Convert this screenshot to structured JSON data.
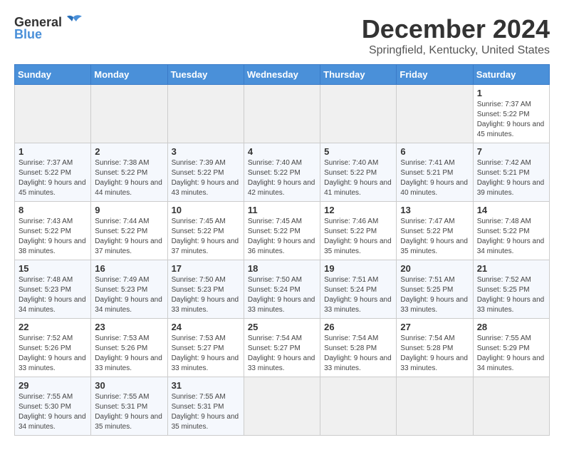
{
  "header": {
    "logo_general": "General",
    "logo_blue": "Blue",
    "month_title": "December 2024",
    "location": "Springfield, Kentucky, United States"
  },
  "calendar": {
    "days_of_week": [
      "Sunday",
      "Monday",
      "Tuesday",
      "Wednesday",
      "Thursday",
      "Friday",
      "Saturday"
    ],
    "weeks": [
      [
        null,
        null,
        null,
        null,
        null,
        null,
        {
          "day": "1",
          "sunrise": "Sunrise: 7:37 AM",
          "sunset": "Sunset: 5:22 PM",
          "daylight": "Daylight: 9 hours and 45 minutes."
        }
      ],
      [
        {
          "day": "1",
          "sunrise": "Sunrise: 7:37 AM",
          "sunset": "Sunset: 5:22 PM",
          "daylight": "Daylight: 9 hours and 45 minutes."
        },
        {
          "day": "2",
          "sunrise": "Sunrise: 7:38 AM",
          "sunset": "Sunset: 5:22 PM",
          "daylight": "Daylight: 9 hours and 44 minutes."
        },
        {
          "day": "3",
          "sunrise": "Sunrise: 7:39 AM",
          "sunset": "Sunset: 5:22 PM",
          "daylight": "Daylight: 9 hours and 43 minutes."
        },
        {
          "day": "4",
          "sunrise": "Sunrise: 7:40 AM",
          "sunset": "Sunset: 5:22 PM",
          "daylight": "Daylight: 9 hours and 42 minutes."
        },
        {
          "day": "5",
          "sunrise": "Sunrise: 7:40 AM",
          "sunset": "Sunset: 5:22 PM",
          "daylight": "Daylight: 9 hours and 41 minutes."
        },
        {
          "day": "6",
          "sunrise": "Sunrise: 7:41 AM",
          "sunset": "Sunset: 5:21 PM",
          "daylight": "Daylight: 9 hours and 40 minutes."
        },
        {
          "day": "7",
          "sunrise": "Sunrise: 7:42 AM",
          "sunset": "Sunset: 5:21 PM",
          "daylight": "Daylight: 9 hours and 39 minutes."
        }
      ],
      [
        {
          "day": "8",
          "sunrise": "Sunrise: 7:43 AM",
          "sunset": "Sunset: 5:22 PM",
          "daylight": "Daylight: 9 hours and 38 minutes."
        },
        {
          "day": "9",
          "sunrise": "Sunrise: 7:44 AM",
          "sunset": "Sunset: 5:22 PM",
          "daylight": "Daylight: 9 hours and 37 minutes."
        },
        {
          "day": "10",
          "sunrise": "Sunrise: 7:45 AM",
          "sunset": "Sunset: 5:22 PM",
          "daylight": "Daylight: 9 hours and 37 minutes."
        },
        {
          "day": "11",
          "sunrise": "Sunrise: 7:45 AM",
          "sunset": "Sunset: 5:22 PM",
          "daylight": "Daylight: 9 hours and 36 minutes."
        },
        {
          "day": "12",
          "sunrise": "Sunrise: 7:46 AM",
          "sunset": "Sunset: 5:22 PM",
          "daylight": "Daylight: 9 hours and 35 minutes."
        },
        {
          "day": "13",
          "sunrise": "Sunrise: 7:47 AM",
          "sunset": "Sunset: 5:22 PM",
          "daylight": "Daylight: 9 hours and 35 minutes."
        },
        {
          "day": "14",
          "sunrise": "Sunrise: 7:48 AM",
          "sunset": "Sunset: 5:22 PM",
          "daylight": "Daylight: 9 hours and 34 minutes."
        }
      ],
      [
        {
          "day": "15",
          "sunrise": "Sunrise: 7:48 AM",
          "sunset": "Sunset: 5:23 PM",
          "daylight": "Daylight: 9 hours and 34 minutes."
        },
        {
          "day": "16",
          "sunrise": "Sunrise: 7:49 AM",
          "sunset": "Sunset: 5:23 PM",
          "daylight": "Daylight: 9 hours and 34 minutes."
        },
        {
          "day": "17",
          "sunrise": "Sunrise: 7:50 AM",
          "sunset": "Sunset: 5:23 PM",
          "daylight": "Daylight: 9 hours and 33 minutes."
        },
        {
          "day": "18",
          "sunrise": "Sunrise: 7:50 AM",
          "sunset": "Sunset: 5:24 PM",
          "daylight": "Daylight: 9 hours and 33 minutes."
        },
        {
          "day": "19",
          "sunrise": "Sunrise: 7:51 AM",
          "sunset": "Sunset: 5:24 PM",
          "daylight": "Daylight: 9 hours and 33 minutes."
        },
        {
          "day": "20",
          "sunrise": "Sunrise: 7:51 AM",
          "sunset": "Sunset: 5:25 PM",
          "daylight": "Daylight: 9 hours and 33 minutes."
        },
        {
          "day": "21",
          "sunrise": "Sunrise: 7:52 AM",
          "sunset": "Sunset: 5:25 PM",
          "daylight": "Daylight: 9 hours and 33 minutes."
        }
      ],
      [
        {
          "day": "22",
          "sunrise": "Sunrise: 7:52 AM",
          "sunset": "Sunset: 5:26 PM",
          "daylight": "Daylight: 9 hours and 33 minutes."
        },
        {
          "day": "23",
          "sunrise": "Sunrise: 7:53 AM",
          "sunset": "Sunset: 5:26 PM",
          "daylight": "Daylight: 9 hours and 33 minutes."
        },
        {
          "day": "24",
          "sunrise": "Sunrise: 7:53 AM",
          "sunset": "Sunset: 5:27 PM",
          "daylight": "Daylight: 9 hours and 33 minutes."
        },
        {
          "day": "25",
          "sunrise": "Sunrise: 7:54 AM",
          "sunset": "Sunset: 5:27 PM",
          "daylight": "Daylight: 9 hours and 33 minutes."
        },
        {
          "day": "26",
          "sunrise": "Sunrise: 7:54 AM",
          "sunset": "Sunset: 5:28 PM",
          "daylight": "Daylight: 9 hours and 33 minutes."
        },
        {
          "day": "27",
          "sunrise": "Sunrise: 7:54 AM",
          "sunset": "Sunset: 5:28 PM",
          "daylight": "Daylight: 9 hours and 33 minutes."
        },
        {
          "day": "28",
          "sunrise": "Sunrise: 7:55 AM",
          "sunset": "Sunset: 5:29 PM",
          "daylight": "Daylight: 9 hours and 34 minutes."
        }
      ],
      [
        {
          "day": "29",
          "sunrise": "Sunrise: 7:55 AM",
          "sunset": "Sunset: 5:30 PM",
          "daylight": "Daylight: 9 hours and 34 minutes."
        },
        {
          "day": "30",
          "sunrise": "Sunrise: 7:55 AM",
          "sunset": "Sunset: 5:31 PM",
          "daylight": "Daylight: 9 hours and 35 minutes."
        },
        {
          "day": "31",
          "sunrise": "Sunrise: 7:55 AM",
          "sunset": "Sunset: 5:31 PM",
          "daylight": "Daylight: 9 hours and 35 minutes."
        },
        null,
        null,
        null,
        null
      ]
    ]
  }
}
